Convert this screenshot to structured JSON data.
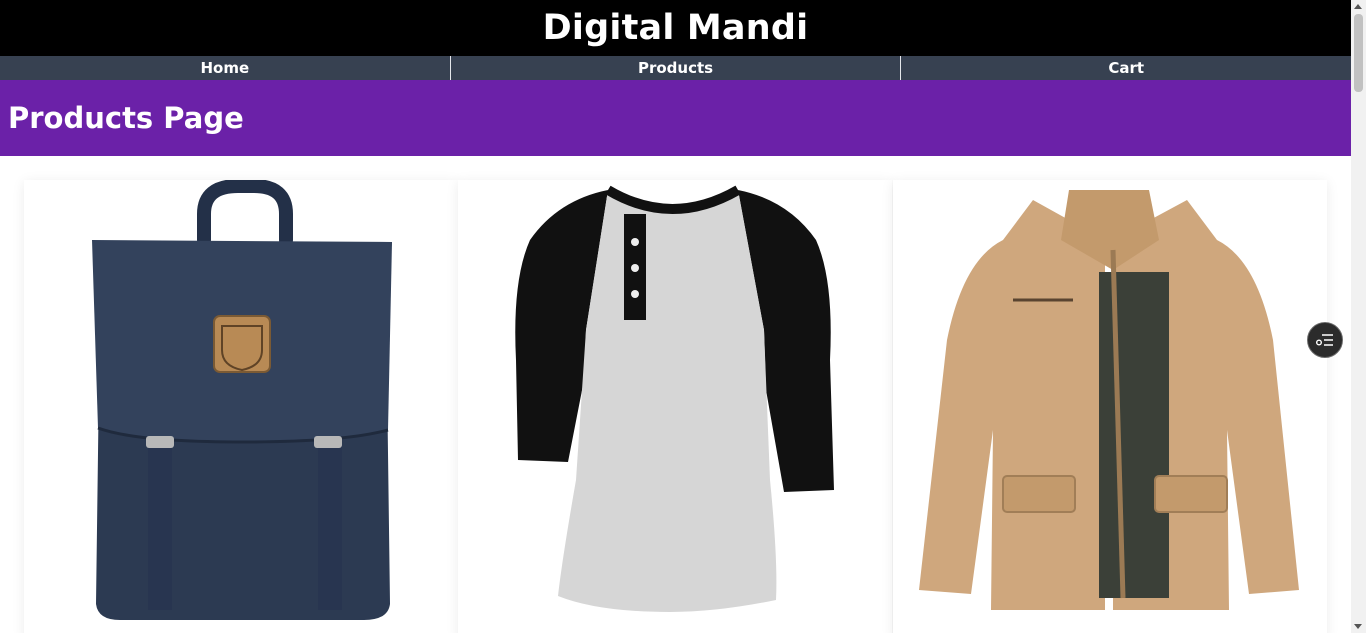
{
  "brand": {
    "title": "Digital Mandi"
  },
  "nav": {
    "items": [
      {
        "label": "Home"
      },
      {
        "label": "Products"
      },
      {
        "label": "Cart"
      }
    ]
  },
  "header": {
    "title": "Products Page"
  },
  "products": [
    {
      "image": "backpack-image",
      "color": "#2c3a52"
    },
    {
      "image": "raglan-henley-tshirt-image",
      "color": "#d7d7d7"
    },
    {
      "image": "khaki-jacket-image",
      "color": "#cfa77d"
    }
  ],
  "floating_button": {
    "icon": "filter-list-icon"
  }
}
